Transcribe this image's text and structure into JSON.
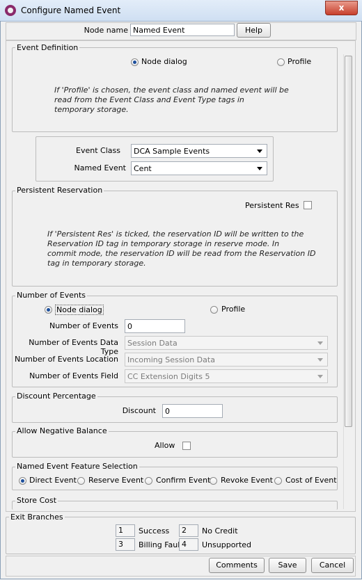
{
  "window": {
    "title": "Configure Named Event",
    "close_label": "x"
  },
  "top": {
    "node_name_label": "Node name",
    "node_name_value": "Named Event",
    "help_label": "Help"
  },
  "event_definition": {
    "legend": "Event Definition",
    "option_node": "Node dialog",
    "option_profile": "Profile",
    "note_1": "If 'Profile' is chosen, the event class and named event will be",
    "note_2": "read from the Event Class and Event Type tags in",
    "note_3": "temporary storage.",
    "event_class_label": "Event Class",
    "event_class_value": "DCA Sample Events",
    "named_event_label": "Named Event",
    "named_event_value": "Cent"
  },
  "persistent_reservation": {
    "legend": "Persistent Reservation",
    "checkbox_label": "Persistent Res",
    "note_1": "If 'Persistent Res' is ticked, the reservation ID will be written to the",
    "note_2": "Reservation ID tag in temporary storage in reserve mode. In",
    "note_3": "commit mode, the reservation ID will be read from the Reservation ID",
    "note_4": "tag in temporary storage."
  },
  "number_of_events": {
    "legend": "Number of Events",
    "option_node": "Node dialog",
    "option_profile": "Profile",
    "count_label": "Number of Events",
    "count_value": "0",
    "datatype_label": "Number of Events Data Type",
    "datatype_value": "Session Data",
    "location_label": "Number of Events Location",
    "location_value": "Incoming Session Data",
    "field_label": "Number of Events Field",
    "field_value": "CC Extension Digits 5"
  },
  "discount": {
    "legend": "Discount Percentage",
    "label": "Discount",
    "value": "0"
  },
  "negative_balance": {
    "legend": "Allow Negative Balance",
    "label": "Allow"
  },
  "feature_selection": {
    "legend": "Named Event Feature Selection",
    "options": [
      "Direct Event",
      "Reserve Event",
      "Confirm Event",
      "Revoke Event",
      "Cost of Event"
    ]
  },
  "store_cost": {
    "legend": "Store Cost"
  },
  "exit_branches": {
    "legend": "Exit Branches",
    "items": [
      {
        "num": "1",
        "label": "Success"
      },
      {
        "num": "2",
        "label": "No Credit"
      },
      {
        "num": "3",
        "label": "Billing Fault"
      },
      {
        "num": "4",
        "label": "Unsupported"
      }
    ]
  },
  "buttons": {
    "comments": "Comments",
    "save": "Save",
    "cancel": "Cancel"
  }
}
